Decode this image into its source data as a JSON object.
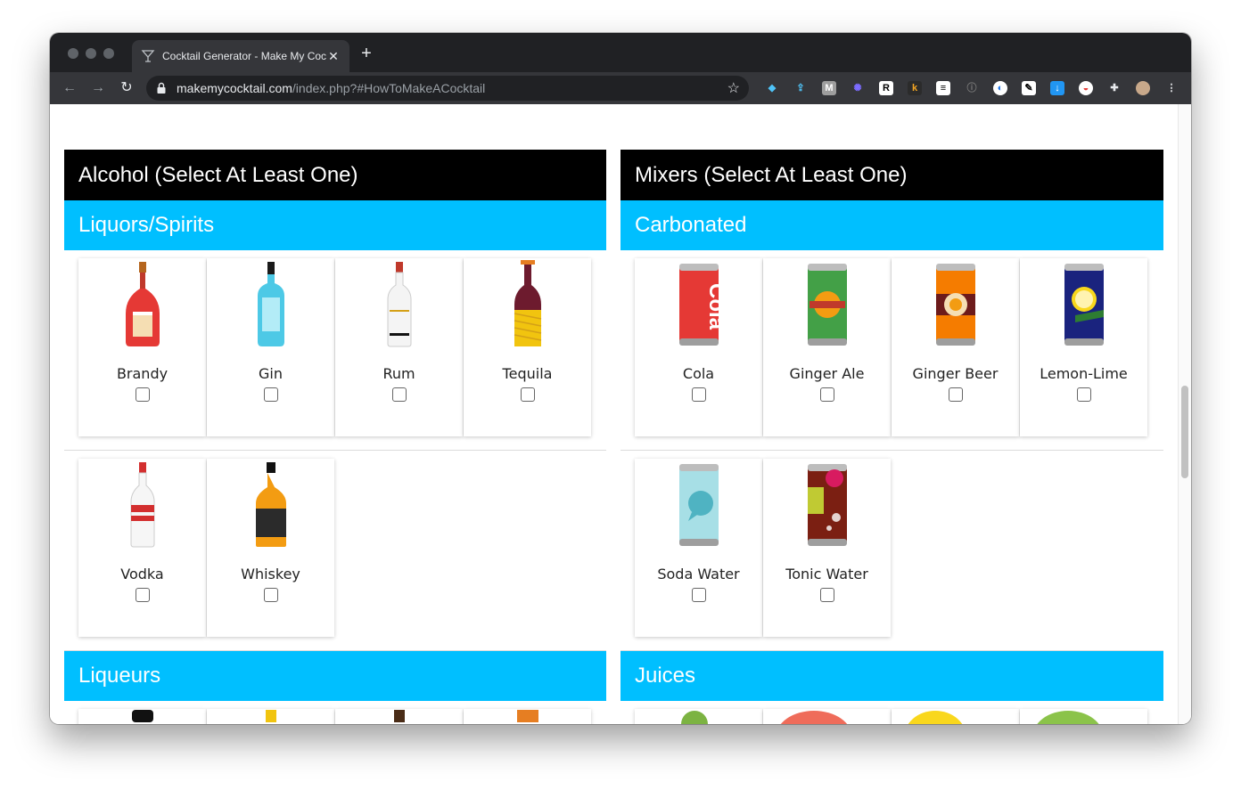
{
  "browser": {
    "tab_title": "Cocktail Generator - Make My Cocktail",
    "url_host": "makemycocktail.com",
    "url_path": "/index.php?#HowToMakeACocktail"
  },
  "colors": {
    "section_header": "#000000",
    "category_header": "#00bfff",
    "chrome_dark": "#202124",
    "chrome_toolbar": "#35363a"
  },
  "alcohol": {
    "title": "Alcohol (Select At Least One)",
    "liquors": {
      "title": "Liquors/Spirits",
      "items": [
        {
          "label": "Brandy",
          "icon": "brandy-bottle-icon",
          "checked": false
        },
        {
          "label": "Gin",
          "icon": "gin-bottle-icon",
          "checked": false
        },
        {
          "label": "Rum",
          "icon": "rum-bottle-icon",
          "checked": false
        },
        {
          "label": "Tequila",
          "icon": "tequila-bottle-icon",
          "checked": false
        },
        {
          "label": "Vodka",
          "icon": "vodka-bottle-icon",
          "checked": false
        },
        {
          "label": "Whiskey",
          "icon": "whiskey-bottle-icon",
          "checked": false
        }
      ]
    },
    "liqueurs": {
      "title": "Liqueurs"
    }
  },
  "mixers": {
    "title": "Mixers (Select At Least One)",
    "carbonated": {
      "title": "Carbonated",
      "items": [
        {
          "label": "Cola",
          "icon": "cola-can-icon",
          "checked": false
        },
        {
          "label": "Ginger Ale",
          "icon": "ginger-ale-can-icon",
          "checked": false
        },
        {
          "label": "Ginger Beer",
          "icon": "ginger-beer-can-icon",
          "checked": false
        },
        {
          "label": "Lemon-Lime",
          "icon": "lemon-lime-can-icon",
          "checked": false
        },
        {
          "label": "Soda Water",
          "icon": "soda-water-can-icon",
          "checked": false
        },
        {
          "label": "Tonic Water",
          "icon": "tonic-water-can-icon",
          "checked": false
        }
      ]
    },
    "juices": {
      "title": "Juices"
    }
  }
}
